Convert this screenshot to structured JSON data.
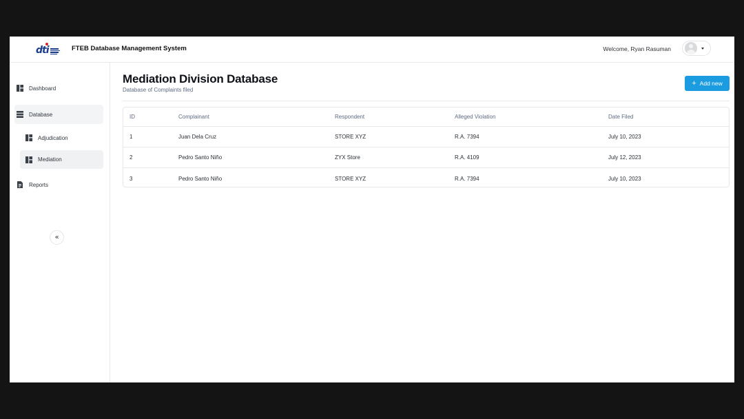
{
  "header": {
    "logo_text": "dti",
    "app_title": "FTEB Database Management System",
    "welcome_text": "Welcome, Ryan Rasuman"
  },
  "sidebar": {
    "items": [
      {
        "label": "Dashboard",
        "icon": "dashboard-icon"
      },
      {
        "label": "Database",
        "icon": "database-icon"
      },
      {
        "label": "Adjudication",
        "icon": "dashboard-icon"
      },
      {
        "label": "Mediation",
        "icon": "dashboard-icon"
      },
      {
        "label": "Reports",
        "icon": "document-icon"
      }
    ],
    "collapse_icon": "double-chevron-left-icon",
    "collapse_glyph": "«"
  },
  "main": {
    "title": "Mediation Division Database",
    "subtitle": "Database of Complaints filed",
    "add_button_label": "Add new",
    "add_button_icon": "+",
    "accent_color": "#1b9be0"
  },
  "table": {
    "columns": [
      "ID",
      "Complainant",
      "Respondent",
      "Alleged Violation",
      "Date Filed"
    ],
    "rows": [
      [
        "1",
        "Juan Dela Cruz",
        "STORE XYZ",
        "R.A. 7394",
        "July 10, 2023"
      ],
      [
        "2",
        "Pedro Santo Niño",
        "ZYX Store",
        "R.A. 4109",
        "July 12, 2023"
      ],
      [
        "3",
        "Pedro Santo Niño",
        "STORE XYZ",
        "R.A. 7394",
        "July 10, 2023"
      ]
    ]
  }
}
